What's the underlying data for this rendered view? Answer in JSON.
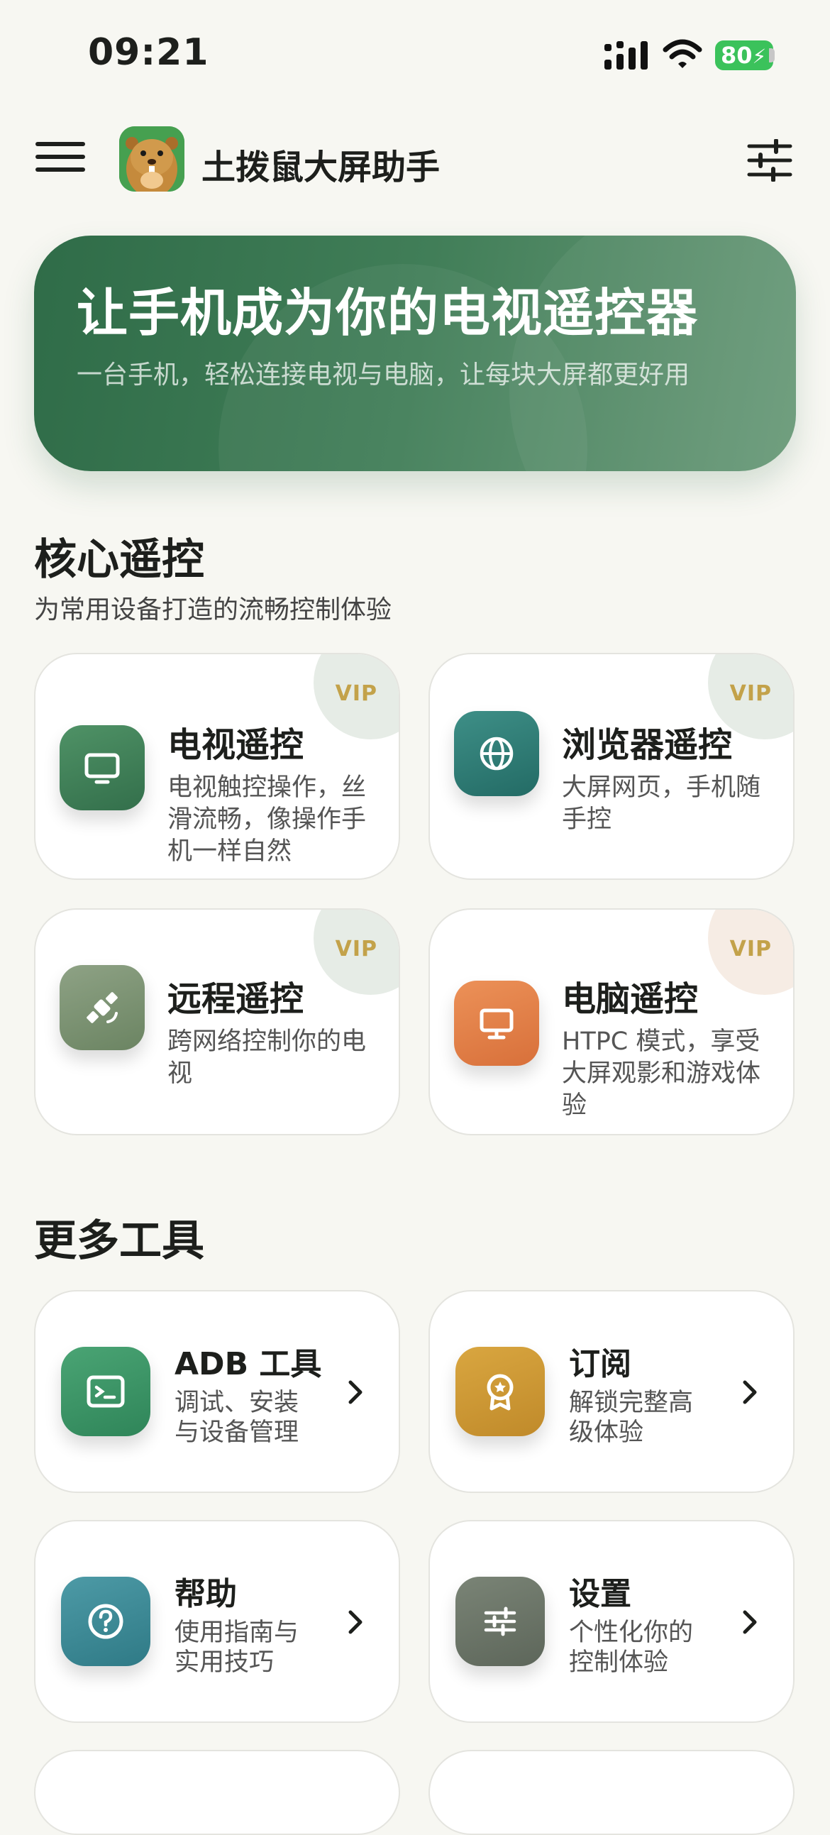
{
  "status_bar": {
    "time": "09:21",
    "battery": "80"
  },
  "header": {
    "title": "土拨鼠大屏助手"
  },
  "hero": {
    "title": "让手机成为你的电视遥控器",
    "subtitle": "一台手机，轻松连接电视与电脑，让每块大屏都更好用"
  },
  "core": {
    "title": "核心遥控",
    "subtitle": "为常用设备打造的流畅控制体验",
    "cards": [
      {
        "title": "电视遥控",
        "desc": "电视触控操作，丝滑流畅，像操作手机一样自然",
        "badge": "VIP",
        "icon": "tv-icon"
      },
      {
        "title": "浏览器遥控",
        "desc": "大屏网页，手机随手控",
        "badge": "VIP",
        "icon": "globe-icon"
      },
      {
        "title": "远程遥控",
        "desc": "跨网络控制你的电视",
        "badge": "VIP",
        "icon": "satellite-icon"
      },
      {
        "title": "电脑遥控",
        "desc": "HTPC 模式，享受大屏观影和游戏体验",
        "badge": "VIP",
        "icon": "monitor-icon"
      }
    ]
  },
  "tools": {
    "title": "更多工具",
    "cards": [
      {
        "title": "ADB 工具",
        "desc": "调试、安装与设备管理",
        "icon": "terminal-icon"
      },
      {
        "title": "订阅",
        "desc": "解锁完整高级体验",
        "icon": "award-icon"
      },
      {
        "title": "帮助",
        "desc": "使用指南与实用技巧",
        "icon": "help-icon"
      },
      {
        "title": "设置",
        "desc": "个性化你的控制体验",
        "icon": "sliders-icon"
      }
    ]
  },
  "colors": {
    "background": "#f7f7f2",
    "hero": "#3a7752",
    "tv": "#3f8158",
    "browser": "#2f7e78",
    "remote": "#7a9471",
    "pc": "#e0834a",
    "adb": "#3a9466",
    "subscribe": "#cf9a33",
    "help": "#3f8c99",
    "settings": "#6d7569",
    "vip": "#c3a24a"
  }
}
